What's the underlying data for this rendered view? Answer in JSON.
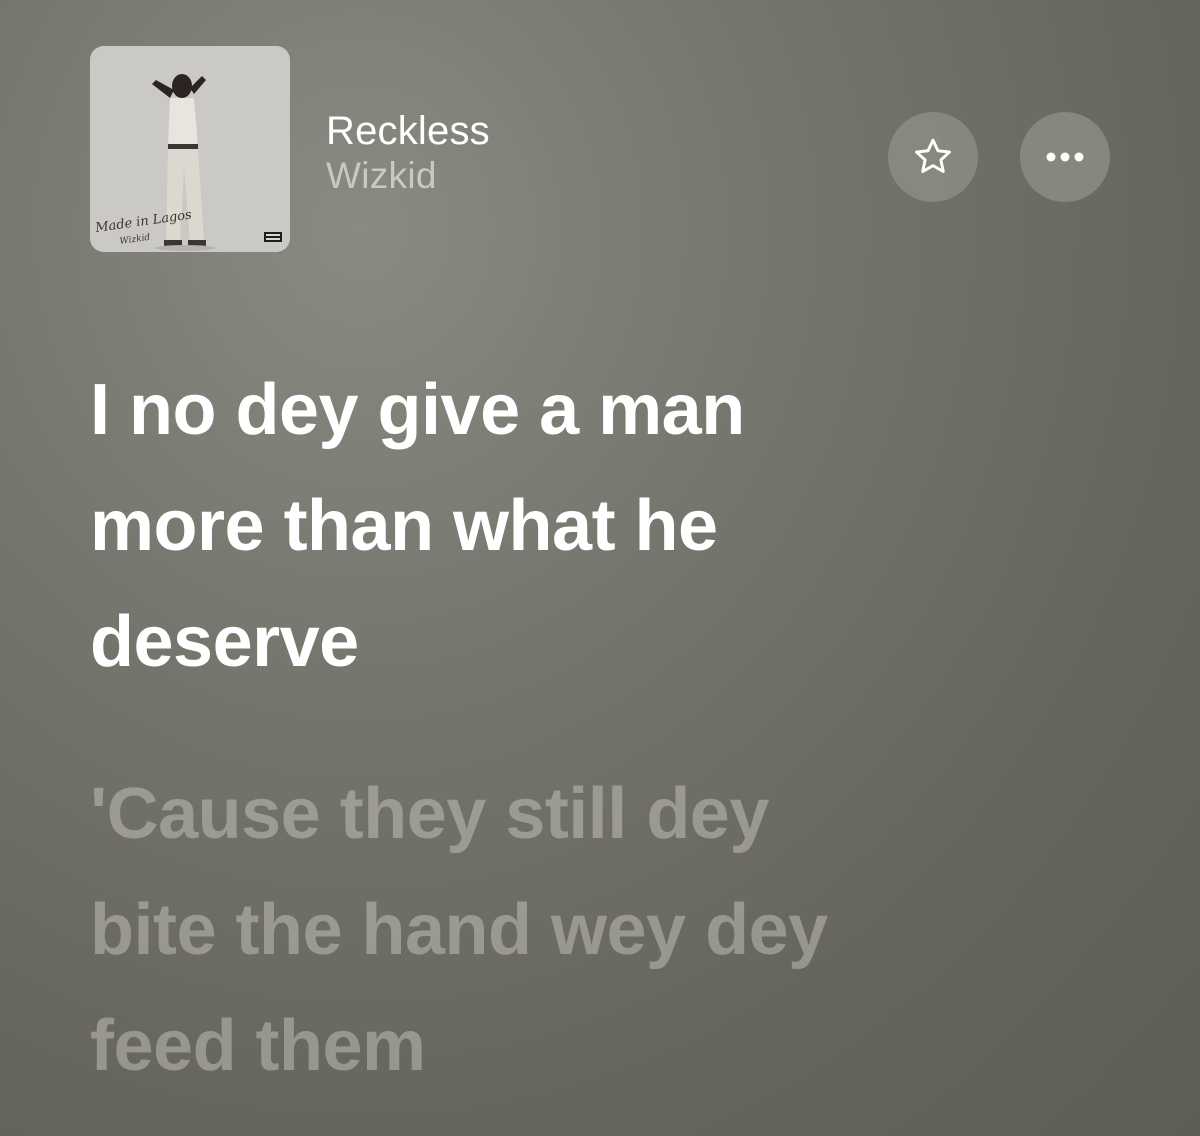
{
  "now_playing": {
    "title": "Reckless",
    "artist": "Wizkid",
    "artwork_text": "Made in Lagos",
    "artwork_subtext": "Wizkid",
    "artwork_icon": "album-artwork"
  },
  "controls": {
    "favorite_icon": "star-icon",
    "more_icon": "ellipsis-icon"
  },
  "lyrics": {
    "active": [
      "I no dey give a man",
      "more than what he",
      "deserve"
    ],
    "next": [
      "'Cause they still dey",
      "bite the hand wey dey",
      "feed them"
    ]
  },
  "colors": {
    "active_lyric": "#ffffff",
    "inactive_lyric": "#a8a7a0",
    "button_bg": "#8c8c84"
  }
}
